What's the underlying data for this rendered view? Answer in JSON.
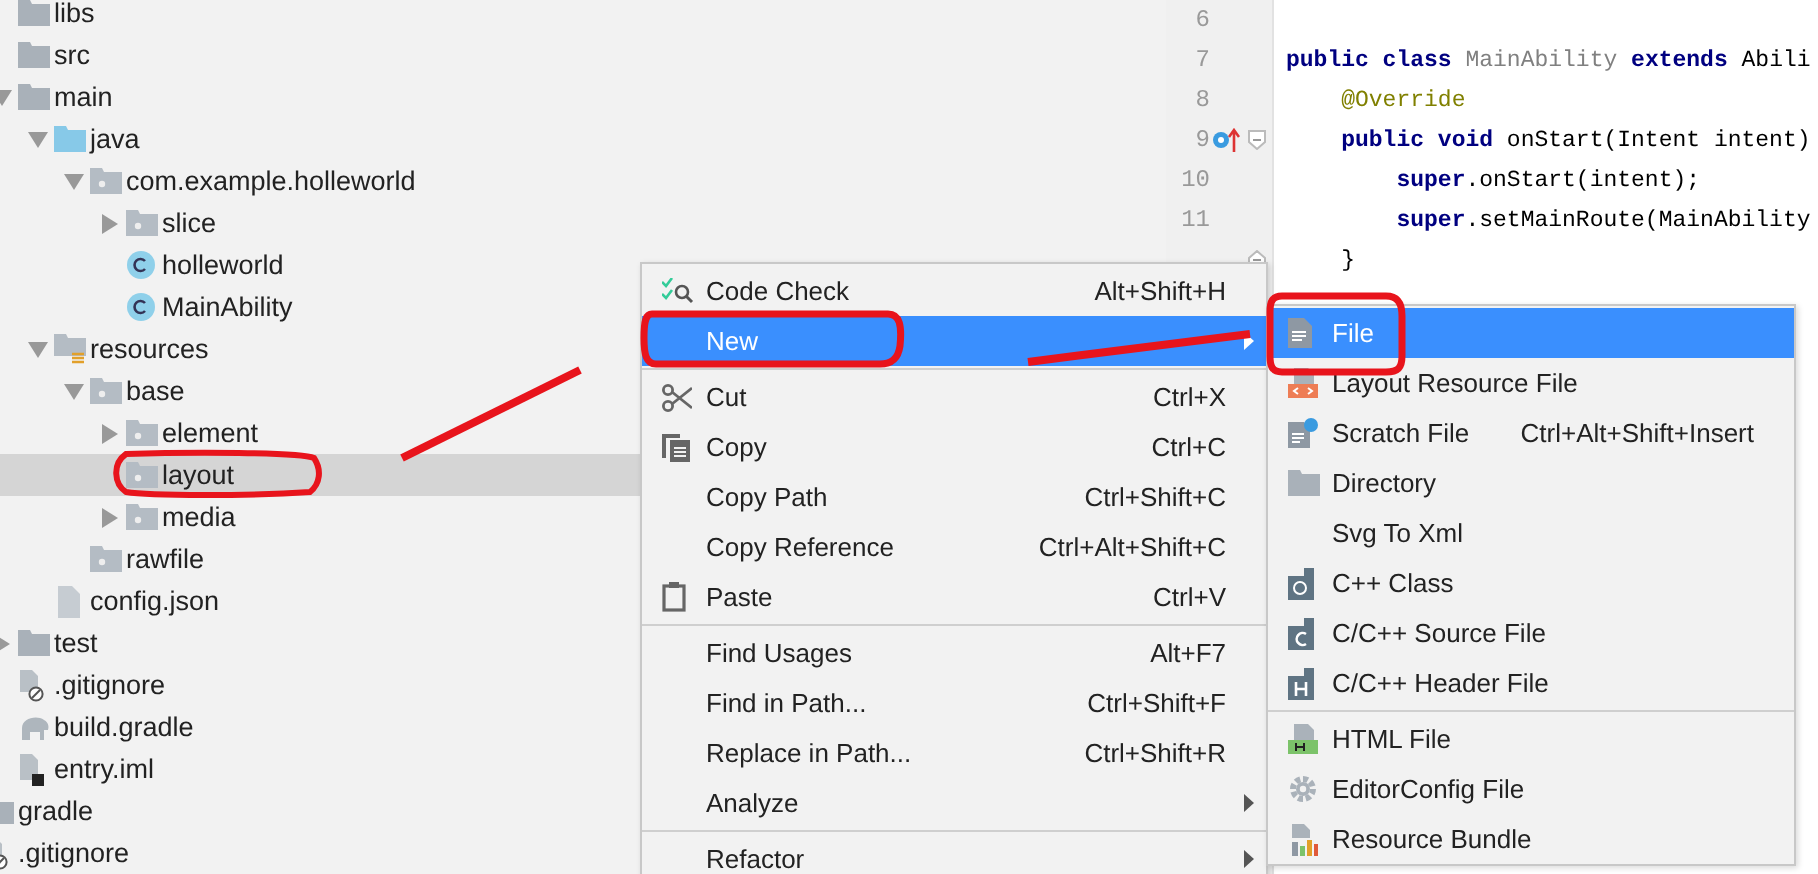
{
  "tree": {
    "items": [
      {
        "kind": "offscreen",
        "children": [
          {
            "label": "libs",
            "kind": "folder"
          },
          {
            "label": "src",
            "kind": "folder"
          },
          {
            "label": "main",
            "kind": "folder",
            "expanded": true,
            "children": [
              {
                "label": "java",
                "kind": "source-folder",
                "expanded": true,
                "children": [
                  {
                    "label": "com.example.holleworld",
                    "kind": "package",
                    "expanded": true,
                    "children": [
                      {
                        "label": "slice",
                        "kind": "package",
                        "expanded": false
                      },
                      {
                        "label": "holleworld",
                        "kind": "class"
                      },
                      {
                        "label": "MainAbility",
                        "kind": "class"
                      }
                    ]
                  }
                ]
              },
              {
                "label": "resources",
                "kind": "resources",
                "expanded": true,
                "children": [
                  {
                    "label": "base",
                    "kind": "package",
                    "expanded": true,
                    "children": [
                      {
                        "label": "element",
                        "kind": "package",
                        "expanded": false,
                        "selected": false
                      },
                      {
                        "label": "layout",
                        "kind": "package",
                        "selected": true
                      },
                      {
                        "label": "media",
                        "kind": "package",
                        "expanded": false,
                        "selected": false
                      }
                    ]
                  },
                  {
                    "label": "rawfile",
                    "kind": "package"
                  }
                ]
              },
              {
                "label": "config.json",
                "kind": "json"
              }
            ]
          },
          {
            "label": "test",
            "kind": "folder",
            "expanded": false
          },
          {
            "label": ".gitignore",
            "kind": "ignore-file"
          },
          {
            "label": "build.gradle",
            "kind": "gradle"
          },
          {
            "label": "entry.iml",
            "kind": "module-file"
          }
        ]
      },
      {
        "label": "gradle",
        "kind": "folder"
      },
      {
        "label": ".gitignore",
        "kind": "ignore-file"
      }
    ]
  },
  "editor": {
    "lines": [
      {
        "number": "6",
        "kind": "plain"
      },
      {
        "number": "7",
        "kind": "plain",
        "tokens": [
          {
            "text": "public class ",
            "kind": "keyword"
          },
          {
            "text": "MainAbility ",
            "kind": "unused"
          },
          {
            "text": "extends ",
            "kind": "keyword"
          },
          {
            "text": "Abili",
            "kind": "plain"
          }
        ]
      },
      {
        "number": "8",
        "kind": "plain",
        "tokens": [
          {
            "text": "    @Override",
            "kind": "annotation"
          }
        ]
      },
      {
        "number": "9",
        "kind": "override-method",
        "tokens": [
          {
            "text": "    public void ",
            "kind": "keyword"
          },
          {
            "text": "onStart(Intent intent)",
            "kind": "plain"
          }
        ]
      },
      {
        "number": "10",
        "kind": "plain",
        "tokens": [
          {
            "text": "        super",
            "kind": "keyword"
          },
          {
            "text": ".onStart(intent);",
            "kind": "plain"
          }
        ]
      },
      {
        "number": "11",
        "kind": "plain",
        "tokens": [
          {
            "text": "        super",
            "kind": "keyword"
          },
          {
            "text": ".setMainRoute(MainAbility",
            "kind": "plain"
          }
        ]
      },
      {
        "kind": "block-end",
        "tokens": [
          {
            "text": "    }",
            "kind": "plain"
          }
        ]
      }
    ]
  },
  "context_menu": {
    "items": [
      {
        "kind": "code-check",
        "label": "Code Check",
        "shortcut": "Alt+Shift+H",
        "selected": false
      },
      {
        "kind": "plain",
        "label": "New",
        "selected": true,
        "submenu": true
      },
      {
        "kind": "separator"
      },
      {
        "kind": "cut",
        "label": "Cut",
        "shortcut": "Ctrl+X",
        "selected": false
      },
      {
        "kind": "copy",
        "label": "Copy",
        "shortcut": "Ctrl+C",
        "selected": false
      },
      {
        "kind": "plain",
        "label": "Copy Path",
        "shortcut": "Ctrl+Shift+C",
        "selected": false
      },
      {
        "kind": "plain",
        "label": "Copy Reference",
        "shortcut": "Ctrl+Alt+Shift+C",
        "selected": false
      },
      {
        "kind": "paste",
        "label": "Paste",
        "shortcut": "Ctrl+V",
        "selected": false
      },
      {
        "kind": "separator"
      },
      {
        "kind": "plain",
        "label": "Find Usages",
        "shortcut": "Alt+F7",
        "selected": false
      },
      {
        "kind": "plain",
        "label": "Find in Path...",
        "shortcut": "Ctrl+Shift+F",
        "selected": false
      },
      {
        "kind": "plain",
        "label": "Replace in Path...",
        "shortcut": "Ctrl+Shift+R",
        "selected": false
      },
      {
        "kind": "plain",
        "label": "Analyze",
        "selected": false,
        "submenu": true
      },
      {
        "kind": "separator"
      },
      {
        "kind": "plain",
        "label": "Refactor",
        "selected": false,
        "submenu": true
      }
    ]
  },
  "new_submenu": {
    "items": [
      {
        "kind": "file",
        "label": "File",
        "selected": true
      },
      {
        "kind": "layout-file",
        "label": "Layout Resource File",
        "selected": false
      },
      {
        "kind": "scratch",
        "label": "Scratch File",
        "shortcut": "Ctrl+Alt+Shift+Insert",
        "selected": false
      },
      {
        "kind": "folder",
        "label": "Directory",
        "selected": false
      },
      {
        "kind": "plain",
        "label": "Svg To Xml",
        "selected": false
      },
      {
        "kind": "cpp-class",
        "label": "C++ Class",
        "selected": false
      },
      {
        "kind": "c-source",
        "label": "C/C++ Source File",
        "selected": false
      },
      {
        "kind": "c-header",
        "label": "C/C++ Header File",
        "selected": false
      },
      {
        "kind": "separator"
      },
      {
        "kind": "html",
        "label": "HTML File",
        "selected": false
      },
      {
        "kind": "gear",
        "label": "EditorConfig File",
        "selected": false
      },
      {
        "kind": "bundle",
        "label": "Resource Bundle",
        "selected": false
      }
    ]
  }
}
